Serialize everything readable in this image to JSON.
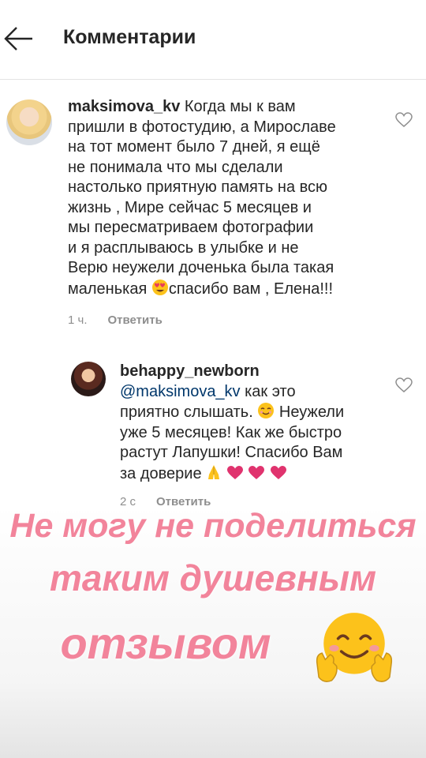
{
  "header": {
    "title": "Комментарии"
  },
  "comments": [
    {
      "username": "maksimova_kv",
      "text_lines": [
        "Когда мы к вам",
        "пришли в фотостудию,  а Мирославе",
        "на тот момент было 7 дней, я ещё",
        "не понимала что мы сделали",
        "настолько приятную память на всю",
        "жизнь , Мире сейчас 5 месяцев и",
        "мы пересматриваем фотографии",
        "и я расплываюсь в улыбке и не",
        "Верю неужели доченька была такая"
      ],
      "last_line_before": "маленькая",
      "last_line_after": "спасибо вам , Елена!!!",
      "time": "1 ч.",
      "reply_label": "Ответить"
    },
    {
      "username": "behappy_newborn",
      "mention": "@maksimova_kv",
      "line1_after_mention": " как это",
      "line2_before": "приятно слышать.",
      "line2_after": " Неужели",
      "line3": "уже 5 месяцев! Как же быстро",
      "line4": "растут Лапушки! Спасибо Вам",
      "line5": "за доверие",
      "time": "2 с",
      "reply_label": "Ответить"
    }
  ],
  "overlay": {
    "line1": "Не могу не поделиться",
    "line2": "таким душевным",
    "line3": "отзывом"
  },
  "colors": {
    "overlay_text": "#f2849b",
    "meta": "#8e8e8e",
    "mention": "#00376b"
  }
}
